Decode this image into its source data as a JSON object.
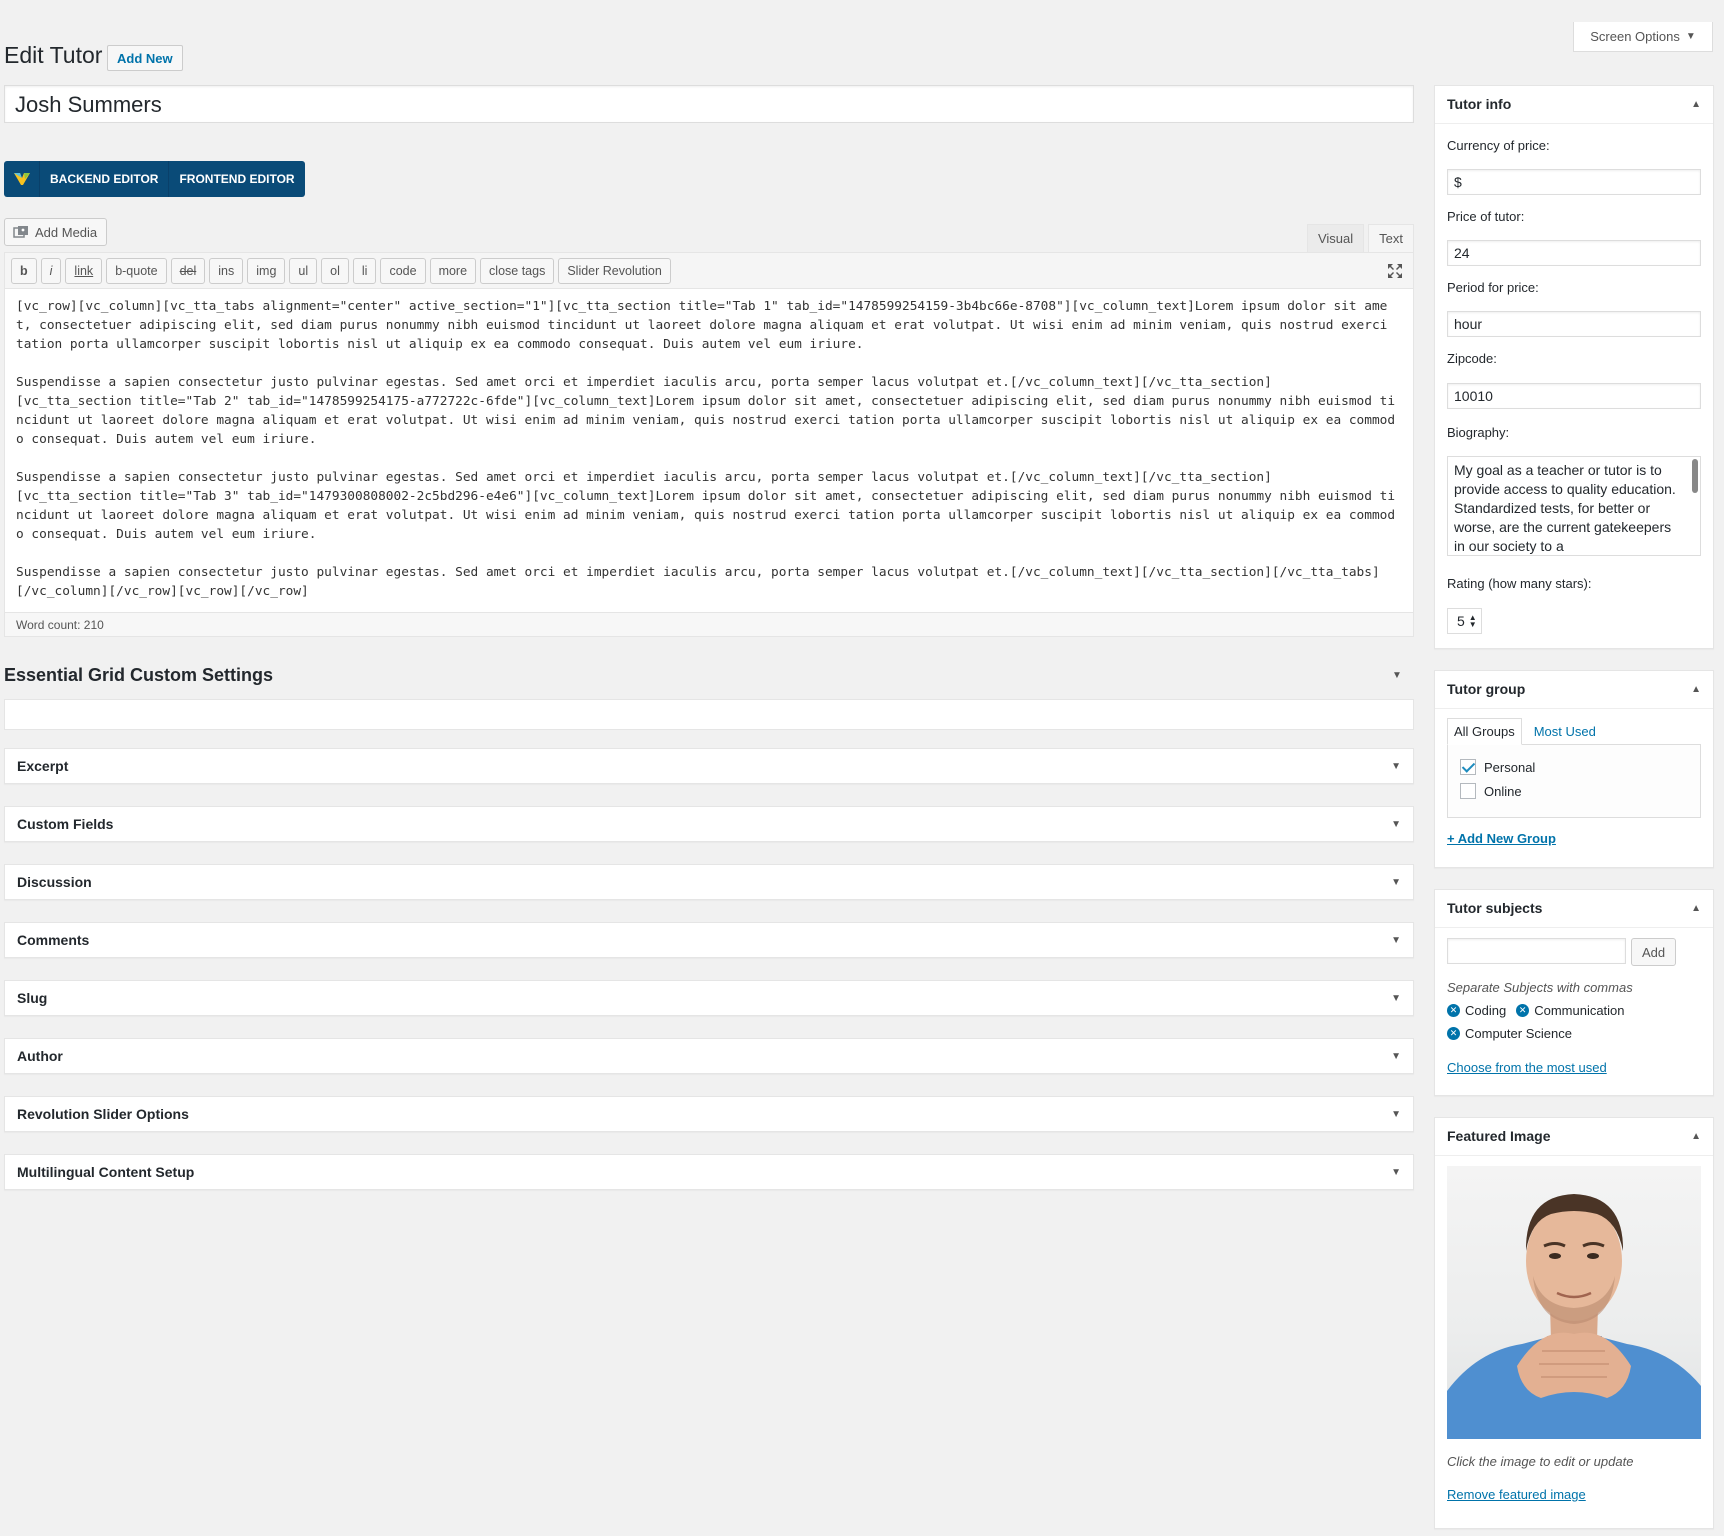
{
  "header": {
    "screen_options": "Screen Options",
    "title": "Edit Tutor",
    "add_new": "Add New"
  },
  "post_title": "Josh Summers",
  "page_builder": {
    "backend_editor": "BACKEND EDITOR",
    "frontend_editor": "FRONTEND EDITOR"
  },
  "editor": {
    "add_media": "Add Media",
    "tabs": {
      "visual": "Visual",
      "text": "Text"
    },
    "toolbar": [
      "b",
      "i",
      "link",
      "b-quote",
      "del",
      "ins",
      "img",
      "ul",
      "ol",
      "li",
      "code",
      "more",
      "close tags",
      "Slider Revolution"
    ],
    "content": "[vc_row][vc_column][vc_tta_tabs alignment=\"center\" active_section=\"1\"][vc_tta_section title=\"Tab 1\" tab_id=\"1478599254159-3b4bc66e-8708\"][vc_column_text]Lorem ipsum dolor sit amet, consectetuer adipiscing elit, sed diam purus nonummy nibh euismod tincidunt ut laoreet dolore magna aliquam et erat volutpat. Ut wisi enim ad minim veniam, quis nostrud exerci tation porta ullamcorper suscipit lobortis nisl ut aliquip ex ea commodo consequat. Duis autem vel eum iriure.\n\nSuspendisse a sapien consectetur justo pulvinar egestas. Sed amet orci et imperdiet iaculis arcu, porta semper lacus volutpat et.[/vc_column_text][/vc_tta_section]\n[vc_tta_section title=\"Tab 2\" tab_id=\"1478599254175-a772722c-6fde\"][vc_column_text]Lorem ipsum dolor sit amet, consectetuer adipiscing elit, sed diam purus nonummy nibh euismod tincidunt ut laoreet dolore magna aliquam et erat volutpat. Ut wisi enim ad minim veniam, quis nostrud exerci tation porta ullamcorper suscipit lobortis nisl ut aliquip ex ea commodo consequat. Duis autem vel eum iriure.\n\nSuspendisse a sapien consectetur justo pulvinar egestas. Sed amet orci et imperdiet iaculis arcu, porta semper lacus volutpat et.[/vc_column_text][/vc_tta_section]\n[vc_tta_section title=\"Tab 3\" tab_id=\"1479300808002-2c5bd296-e4e6\"][vc_column_text]Lorem ipsum dolor sit amet, consectetuer adipiscing elit, sed diam purus nonummy nibh euismod tincidunt ut laoreet dolore magna aliquam et erat volutpat. Ut wisi enim ad minim veniam, quis nostrud exerci tation porta ullamcorper suscipit lobortis nisl ut aliquip ex ea commodo consequat. Duis autem vel eum iriure.\n\nSuspendisse a sapien consectetur justo pulvinar egestas. Sed amet orci et imperdiet iaculis arcu, porta semper lacus volutpat et.[/vc_column_text][/vc_tta_section][/vc_tta_tabs]\n[/vc_column][/vc_row][vc_row][/vc_row]",
    "word_count": "Word count: 210"
  },
  "essential_grid": {
    "title": "Essential Grid Custom Settings"
  },
  "metaboxes": [
    "Excerpt",
    "Custom Fields",
    "Discussion",
    "Comments",
    "Slug",
    "Author",
    "Revolution Slider Options",
    "Multilingual Content Setup"
  ],
  "tutor_info": {
    "title": "Tutor info",
    "currency_label": "Currency of price:",
    "currency_value": "$",
    "price_label": "Price of tutor:",
    "price_value": "24",
    "period_label": "Period for price:",
    "period_value": "hour",
    "zip_label": "Zipcode:",
    "zip_value": "10010",
    "bio_label": "Biography:",
    "bio_value": "My goal as a teacher or tutor is to provide access to quality education. Standardized tests, for better or worse, are the current gatekeepers in our society to a",
    "rating_label": "Rating (how many stars):",
    "rating_value": "5"
  },
  "tutor_group": {
    "title": "Tutor group",
    "tab_all": "All Groups",
    "tab_most_used": "Most Used",
    "options": [
      {
        "label": "Personal",
        "checked": true
      },
      {
        "label": "Online",
        "checked": false
      }
    ],
    "add_new": "+ Add New Group"
  },
  "tutor_subjects": {
    "title": "Tutor subjects",
    "add_button": "Add",
    "hint": "Separate Subjects with commas",
    "tags": [
      "Coding",
      "Communication",
      "Computer Science"
    ],
    "choose_link": "Choose from the most used"
  },
  "featured_image": {
    "title": "Featured Image",
    "hint": "Click the image to edit or update",
    "remove_link": "Remove featured image"
  },
  "colors": {
    "admin_link": "#0073aa",
    "vc_button": "#0a4b78",
    "background": "#f1f1f1"
  }
}
